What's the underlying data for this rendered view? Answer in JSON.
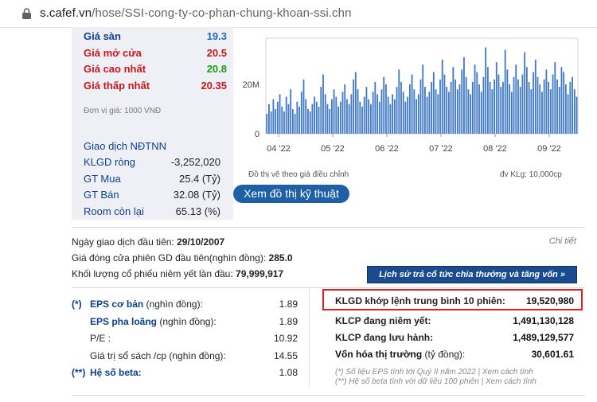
{
  "browser": {
    "url_host": "s.cafef.vn",
    "url_path": "/hose/SSI-cong-ty-co-phan-chung-khoan-ssi.chn"
  },
  "prices": [
    {
      "label": "Giá sàn",
      "value": "19.3"
    },
    {
      "label": "Giá mở cửa",
      "value": "20.5"
    },
    {
      "label": "Giá cao nhất",
      "value": "20.8"
    },
    {
      "label": "Giá thấp nhất",
      "value": "20.35"
    }
  ],
  "unit_note": "Đơn vị giá: 1000 VNĐ",
  "foreign": {
    "title": "Giao dịch NĐTNN",
    "rows": [
      {
        "label": "KLGD ròng",
        "value": "-3,252,020"
      },
      {
        "label": "GT Mua",
        "value": "25.4 (Tỷ)"
      },
      {
        "label": "GT Bán",
        "value": "32.08 (Tỷ)"
      },
      {
        "label": "Room còn lại",
        "value": "65.13 (%)"
      }
    ]
  },
  "chart_data": {
    "type": "bar",
    "title": "",
    "y_tick_labels": [
      "20M",
      "0"
    ],
    "x_tick_labels": [
      "04 '22",
      "05 '22",
      "06 '22",
      "07 '22",
      "08 '22",
      "09 '22"
    ],
    "values_million": [
      8,
      12,
      9,
      14,
      10,
      13,
      16,
      11,
      9,
      15,
      12,
      18,
      10,
      8,
      13,
      11,
      17,
      22,
      14,
      10,
      9,
      12,
      15,
      13,
      11,
      19,
      24,
      16,
      12,
      10,
      14,
      18,
      15,
      11,
      13,
      17,
      20,
      14,
      12,
      16,
      22,
      25,
      18,
      13,
      11,
      15,
      19,
      14,
      12,
      17,
      21,
      16,
      13,
      18,
      23,
      20,
      15,
      12,
      16,
      14,
      19,
      26,
      21,
      17,
      13,
      15,
      20,
      24,
      18,
      14,
      16,
      22,
      28,
      19,
      15,
      17,
      21,
      25,
      18,
      16,
      22,
      30,
      24,
      19,
      17,
      21,
      27,
      22,
      18,
      20,
      26,
      31,
      23,
      18,
      16,
      21,
      28,
      25,
      20,
      17,
      23,
      35,
      27,
      21,
      18,
      22,
      29,
      24,
      19,
      21,
      34,
      26,
      20,
      17,
      23,
      28,
      22,
      19,
      24,
      33,
      27,
      21,
      18,
      25,
      30,
      23,
      20,
      17,
      22,
      26,
      21,
      18,
      24,
      29,
      22,
      19,
      27,
      25,
      20,
      16,
      21,
      23,
      18,
      15
    ]
  },
  "chart_note": "Đồ thị vẽ theo giá điều chỉnh",
  "chart_unit": "đv KLg: 10,000cp",
  "chart_button": "Xem đồ thị kỹ thuật",
  "info": {
    "first_trade_label": "Ngày giao dịch đầu tiên:",
    "first_trade_value": "29/10/2007",
    "first_close_label": "Giá đóng cửa phiên GD đầu tiên(nghìn đồng):",
    "first_close_value": "285.0",
    "first_volume_label": "Khối lượng cổ phiếu niêm yết lần đầu:",
    "first_volume_value": "79,999,917",
    "detail_link": "Chi tiết",
    "history_button": "Lịch sử trả cổ tức chia thưởng và tăng vốn »"
  },
  "eps": [
    {
      "mark": "(*)",
      "label_bold": "EPS cơ bản",
      "label_rest": " (nghìn đồng):",
      "value": "1.89"
    },
    {
      "mark": "",
      "label_bold": "EPS pha loãng",
      "label_rest": " (nghìn đồng):",
      "value": "1.89"
    },
    {
      "mark": "",
      "label_bold": "",
      "label_rest": "P/E :",
      "value": "10.92"
    },
    {
      "mark": "",
      "label_bold": "",
      "label_rest": "Giá trị sổ sách /cp (nghìn đồng):",
      "value": "14.55"
    },
    {
      "mark": "(**)",
      "label_bold": "Hệ số beta:",
      "label_rest": "",
      "value": "1.08"
    }
  ],
  "stats": [
    {
      "label": "KLGD khớp lệnh trung bình 10 phiên:",
      "value": "19,520,980"
    },
    {
      "label": "KLCP đang niêm yết:",
      "value": "1,491,130,128"
    },
    {
      "label": "KLCP đang lưu hành:",
      "value": "1,489,129,577"
    },
    {
      "label": "Vốn hóa thị trường",
      "label_rest": " (tỷ đồng):",
      "value": "30,601.61"
    }
  ],
  "footnotes": [
    "(*) Số liệu EPS tính tới Quý II năm 2022 | Xem cách tính",
    "(**) Hệ số beta tính với dữ liệu 100 phiên | Xem cách tính"
  ],
  "colors": {
    "accent_blue": "#0d3f8f",
    "price_red": "#c8161d",
    "price_green": "#1a9b1a",
    "bar_blue": "#3f78c9",
    "highlight_red": "#e02020"
  }
}
